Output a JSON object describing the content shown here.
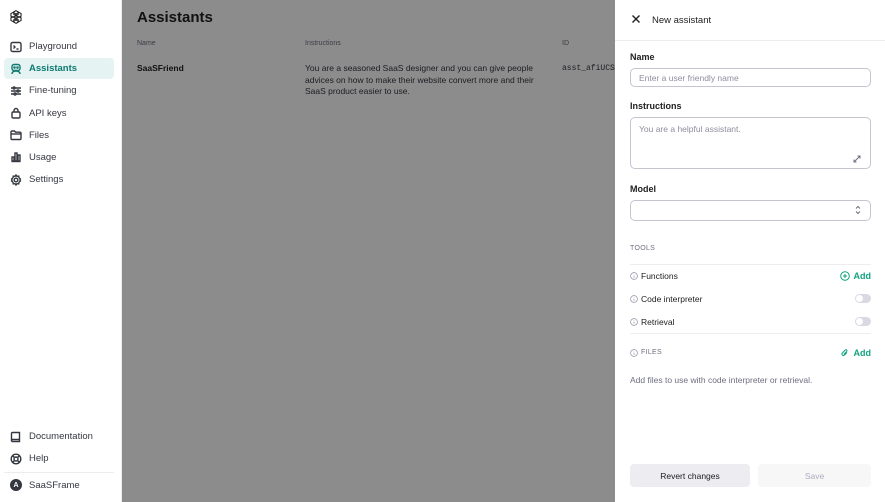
{
  "sidebar": {
    "items": [
      {
        "label": "Playground",
        "icon": "terminal-icon"
      },
      {
        "label": "Assistants",
        "icon": "robot-icon"
      },
      {
        "label": "Fine-tuning",
        "icon": "tune-icon"
      },
      {
        "label": "API keys",
        "icon": "lock-icon"
      },
      {
        "label": "Files",
        "icon": "folder-icon"
      },
      {
        "label": "Usage",
        "icon": "bar-chart-icon"
      },
      {
        "label": "Settings",
        "icon": "gear-icon"
      }
    ],
    "bottom": [
      {
        "label": "Documentation",
        "icon": "book-icon"
      },
      {
        "label": "Help",
        "icon": "help-icon"
      }
    ],
    "org": {
      "initial": "A",
      "name": "SaaSFrame"
    },
    "active": "Assistants"
  },
  "main": {
    "title": "Assistants",
    "columns": [
      "Name",
      "Instructions",
      "ID"
    ],
    "rows": [
      {
        "name": "SaaSFriend",
        "instructions": "You are a seasoned SaaS designer and you can give people advices on how to make their website convert more and their SaaS product easier to use.",
        "id": "asst_afiUCS"
      }
    ]
  },
  "panel": {
    "title": "New assistant",
    "name_label": "Name",
    "name_placeholder": "Enter a user friendly name",
    "instructions_label": "Instructions",
    "instructions_placeholder": "You are a helpful assistant.",
    "model_label": "Model",
    "model_value": "",
    "tools_heading": "TOOLS",
    "tools": [
      {
        "label": "Functions",
        "control": "add",
        "action_label": "Add"
      },
      {
        "label": "Code interpreter",
        "control": "toggle",
        "enabled": false
      },
      {
        "label": "Retrieval",
        "control": "toggle",
        "enabled": false
      }
    ],
    "files_heading": "FILES",
    "files_add_label": "Add",
    "files_hint": "Add files to use with code interpreter or retrieval.",
    "revert_label": "Revert changes",
    "save_label": "Save"
  },
  "colors": {
    "accent": "#10a37f",
    "active_nav_bg": "#e6f3f3",
    "active_nav_text": "#0d7a70"
  }
}
